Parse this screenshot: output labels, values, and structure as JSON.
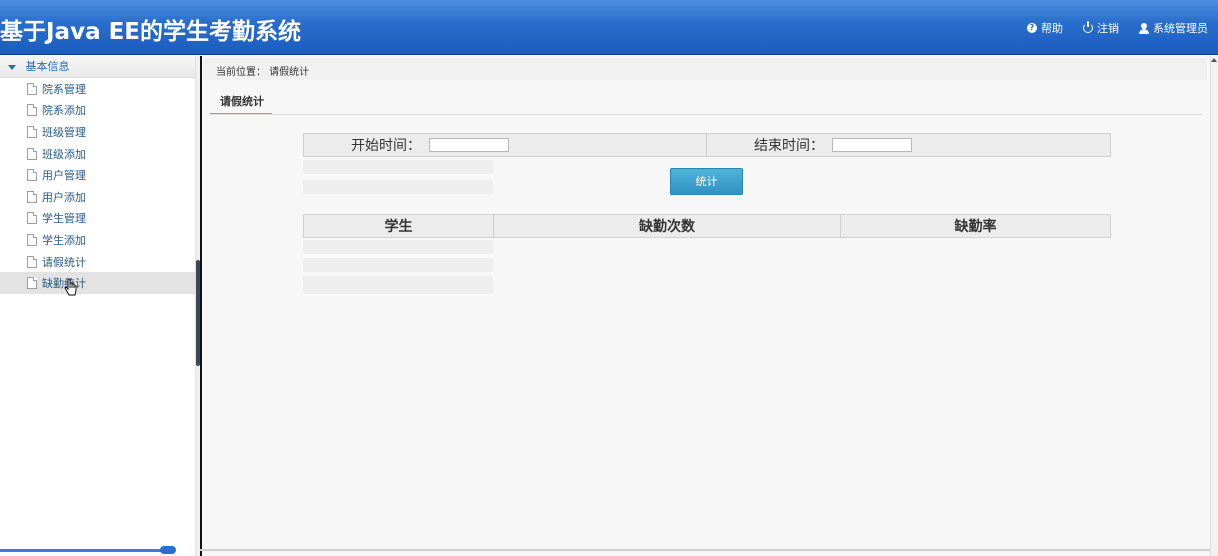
{
  "header": {
    "title": "基于Java EE的学生考勤系统",
    "links": {
      "help": "帮助",
      "logout": "注销",
      "user": "系统管理员"
    }
  },
  "sidebar": {
    "group_label": "基本信息",
    "items": [
      {
        "label": "院系管理"
      },
      {
        "label": "院系添加"
      },
      {
        "label": "班级管理"
      },
      {
        "label": "班级添加"
      },
      {
        "label": "用户管理"
      },
      {
        "label": "用户添加"
      },
      {
        "label": "学生管理"
      },
      {
        "label": "学生添加"
      },
      {
        "label": "请假统计"
      },
      {
        "label": "缺勤统计"
      }
    ]
  },
  "main": {
    "breadcrumb": "当前位置：  请假统计",
    "tab_label": "请假统计",
    "form": {
      "start_label": "开始时间：",
      "end_label": "结束时间：",
      "start_value": "",
      "end_value": ""
    },
    "button_label": "统计",
    "table": {
      "headers": [
        "学生",
        "缺勤次数",
        "缺勤率"
      ]
    }
  }
}
